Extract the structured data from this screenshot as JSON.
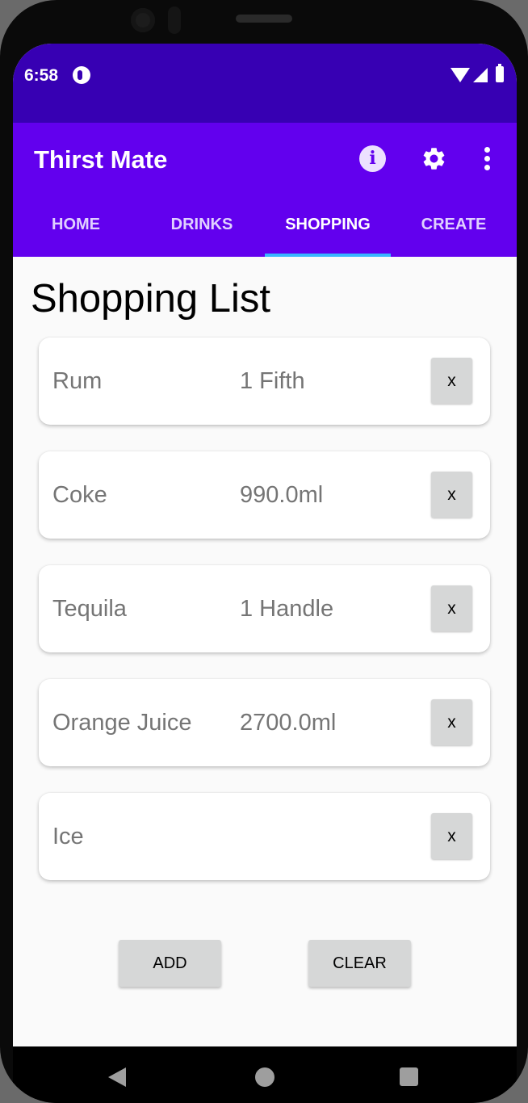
{
  "status_bar": {
    "time": "6:58"
  },
  "app_bar": {
    "title": "Thirst Mate"
  },
  "tabs": [
    {
      "label": "HOME",
      "active": false
    },
    {
      "label": "DRINKS",
      "active": false
    },
    {
      "label": "SHOPPING",
      "active": true
    },
    {
      "label": "CREATE",
      "active": false
    }
  ],
  "page": {
    "heading": "Shopping List"
  },
  "items": [
    {
      "name": "Rum",
      "quantity": "1 Fifth",
      "remove_label": "x"
    },
    {
      "name": "Coke",
      "quantity": "990.0ml",
      "remove_label": "x"
    },
    {
      "name": "Tequila",
      "quantity": "1 Handle",
      "remove_label": "x"
    },
    {
      "name": "Orange Juice",
      "quantity": "2700.0ml",
      "remove_label": "x"
    },
    {
      "name": "Ice",
      "quantity": "",
      "remove_label": "x"
    }
  ],
  "actions": {
    "add_label": "ADD",
    "clear_label": "CLEAR"
  },
  "icons": {
    "status": [
      "notification-icon",
      "wifi-icon",
      "cell-signal-icon",
      "battery-icon"
    ],
    "app_bar": [
      "info-icon",
      "gear-icon",
      "more-vert-icon"
    ],
    "nav": [
      "back-icon",
      "home-icon",
      "recents-icon"
    ]
  },
  "colors": {
    "status_bar": "#3700b3",
    "app_bar": "#6200ee",
    "tab_indicator": "#38b6ff",
    "background": "#fafafa",
    "button": "#d6d7d7"
  }
}
